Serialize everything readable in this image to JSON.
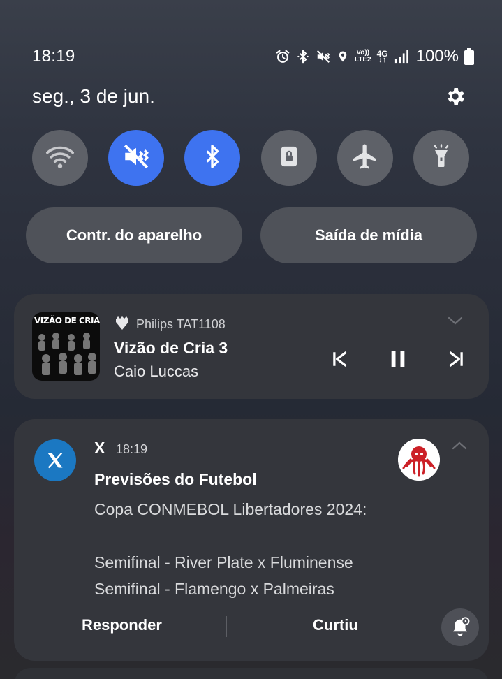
{
  "status_bar": {
    "time": "18:19",
    "volte_label": "Vo))",
    "lte_label": "LTE2",
    "network_label": "4G",
    "battery": "100%",
    "icons": [
      "alarm-icon",
      "bluetooth-icon",
      "vibrate-icon",
      "location-icon",
      "volte-icon",
      "data-arrows-icon",
      "signal-icon",
      "battery-icon"
    ]
  },
  "header": {
    "date": "seg., 3 de jun."
  },
  "quick_toggles": [
    {
      "name": "wifi",
      "icon": "wifi-icon",
      "active": false
    },
    {
      "name": "vibrate",
      "icon": "vibrate-icon",
      "active": true
    },
    {
      "name": "bluetooth",
      "icon": "bluetooth-icon",
      "active": true
    },
    {
      "name": "rotation-lock",
      "icon": "lock-icon",
      "active": false
    },
    {
      "name": "airplane",
      "icon": "airplane-icon",
      "active": false
    },
    {
      "name": "flashlight",
      "icon": "flashlight-icon",
      "active": false
    }
  ],
  "pills": {
    "device_control": "Contr. do aparelho",
    "media_output": "Saída de mídia"
  },
  "media": {
    "album_title": "VIZÃO DE CRIA 3",
    "device": "Philips TAT1108",
    "title": "Vizão de Cria 3",
    "artist": "Caio Luccas"
  },
  "notification": {
    "app": "X",
    "time": "18:19",
    "title": "Previsões do Futebol",
    "body": [
      "Copa CONMEBOL Libertadores 2024:",
      "",
      "Semifinal - River Plate x Fluminense",
      "Semifinal - Flamengo x Palmeiras"
    ],
    "actions": {
      "reply": "Responder",
      "like": "Curtiu"
    }
  },
  "colors": {
    "accent_blue": "#3e73f0",
    "toggle_off": "#5e6168",
    "card_bg": "#34363c",
    "x_badge": "#1b78c2"
  }
}
